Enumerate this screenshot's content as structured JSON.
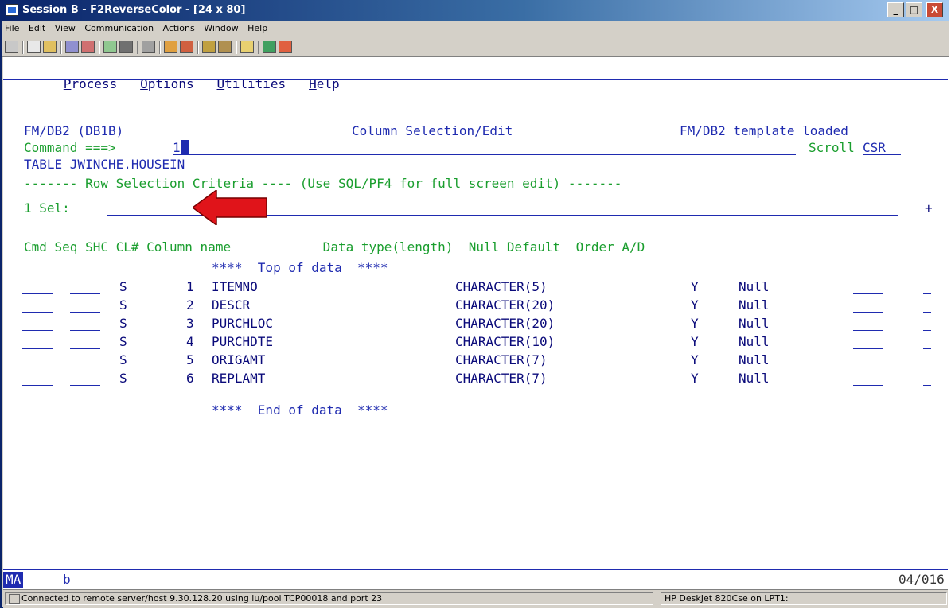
{
  "window": {
    "title": "Session B - F2ReverseColor - [24 x 80]",
    "controls": [
      "_",
      "□",
      "X"
    ]
  },
  "menubar": [
    "File",
    "Edit",
    "View",
    "Communication",
    "Actions",
    "Window",
    "Help"
  ],
  "app_menu": {
    "items": [
      {
        "mnemonic": "P",
        "rest": "rocess"
      },
      {
        "mnemonic": "O",
        "rest": "ptions"
      },
      {
        "mnemonic": "U",
        "rest": "tilities"
      },
      {
        "mnemonic": "H",
        "rest": "elp"
      }
    ]
  },
  "header": {
    "left": "FM/DB2 (DB1B)",
    "center": "Column Selection/Edit",
    "right": "FM/DB2 template loaded"
  },
  "command": {
    "label": "Command ===>",
    "value": "1",
    "scroll_label": "Scroll",
    "scroll_value": "CSR"
  },
  "table_line": "TABLE JWINCHE.HOUSEIN",
  "criteria_line": "------- Row Selection Criteria ---- (Use SQL/PF4 for full screen edit) -------",
  "sel": {
    "label": "1 Sel:",
    "value": "",
    "more": "+"
  },
  "columns_header": "Cmd Seq SHC CL# Column name            Data type(length)  Null Default  Order A/D",
  "top_marker": "****  Top of data  ****",
  "end_marker": "****  End of data  ****",
  "rows": [
    {
      "shc": "S",
      "num": "1",
      "name": "ITEMNO",
      "type": "CHARACTER(5)",
      "null": "Y",
      "default": "Null"
    },
    {
      "shc": "S",
      "num": "2",
      "name": "DESCR",
      "type": "CHARACTER(20)",
      "null": "Y",
      "default": "Null"
    },
    {
      "shc": "S",
      "num": "3",
      "name": "PURCHLOC",
      "type": "CHARACTER(20)",
      "null": "Y",
      "default": "Null"
    },
    {
      "shc": "S",
      "num": "4",
      "name": "PURCHDTE",
      "type": "CHARACTER(10)",
      "null": "Y",
      "default": "Null"
    },
    {
      "shc": "S",
      "num": "5",
      "name": "ORIGAMT",
      "type": "CHARACTER(7)",
      "null": "Y",
      "default": "Null"
    },
    {
      "shc": "S",
      "num": "6",
      "name": "REPLAMT",
      "type": "CHARACTER(7)",
      "null": "Y",
      "default": "Null"
    }
  ],
  "oia": {
    "left": "MA",
    "mid": "b",
    "right": "04/016"
  },
  "statusbar": {
    "connection": "Connected to remote server/host 9.30.128.20 using lu/pool TCP00018 and port 23",
    "printer": "HP DeskJet 820Cse on LPT1:"
  },
  "colors": {
    "title_bar": "#0a246a",
    "field_text": "#1f2bb0",
    "label_text": "#1a9e2e",
    "arrow": "#e0141a"
  }
}
